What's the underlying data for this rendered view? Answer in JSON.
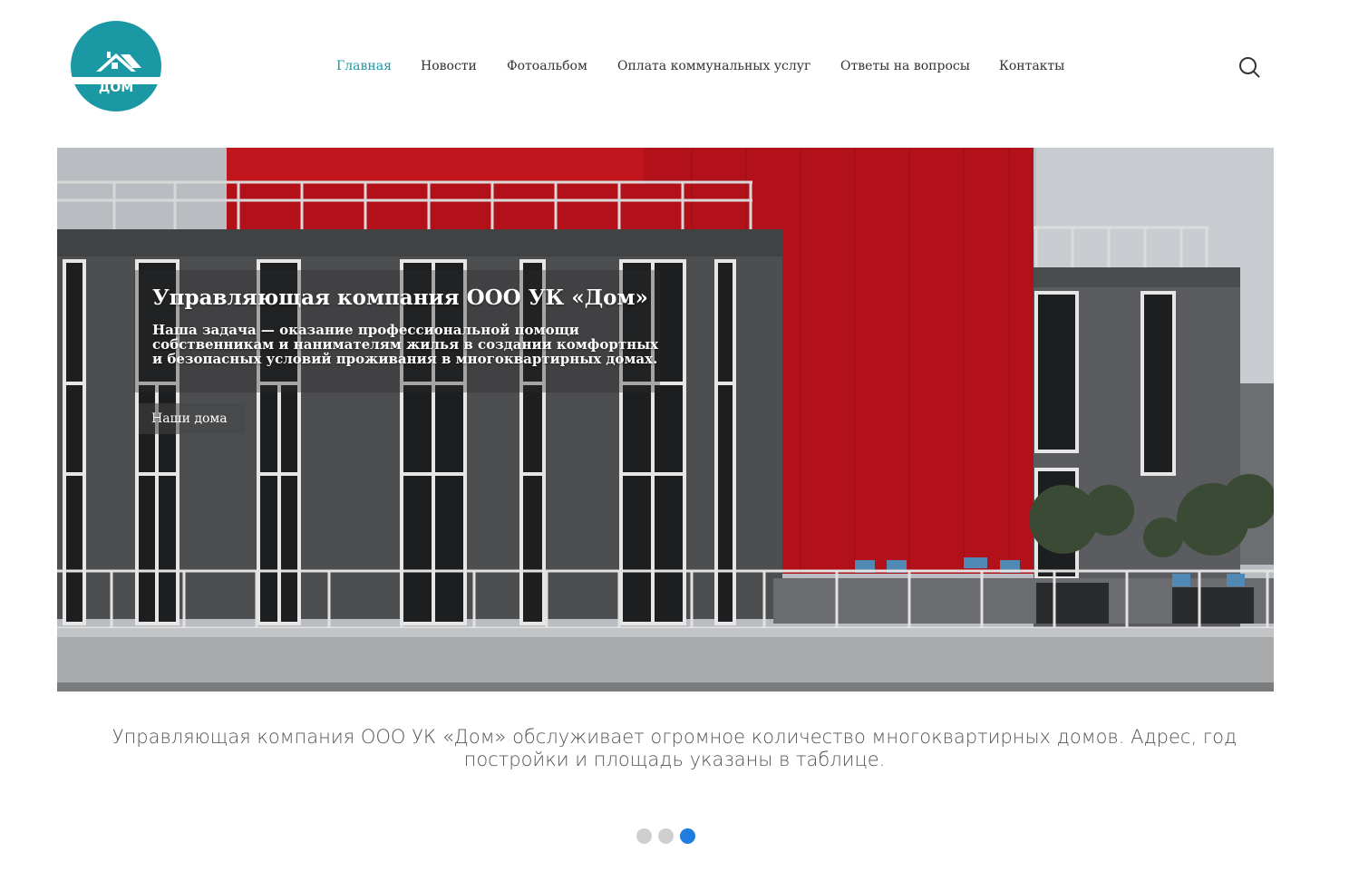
{
  "logo": {
    "text": "ДОМ",
    "color": "#1a98a4"
  },
  "nav": {
    "items": [
      {
        "label": "Главная",
        "active": true
      },
      {
        "label": "Новости"
      },
      {
        "label": "Фотоальбом"
      },
      {
        "label": "Оплата коммунальных услуг"
      },
      {
        "label": "Ответы на вопросы"
      },
      {
        "label": "Контакты"
      }
    ],
    "active_color": "#1a98a4",
    "search_icon": "search-icon"
  },
  "hero": {
    "title": "Управляющая компания ООО УК «Дом»",
    "text": "Наша задача — оказание профессиональной помощи собственникам и нанимателям жилья в создании комфортных и безопасных условий проживания в многоквартирных домах.",
    "button": "Наши дома"
  },
  "caption": "Управляющая компания ООО УК «Дом» обслуживает огромное количество многоквартирных домов. Адрес, год постройки и площадь указаны в таблице.",
  "slider": {
    "slides": 3,
    "active": 3,
    "active_color": "#1e7de0"
  }
}
